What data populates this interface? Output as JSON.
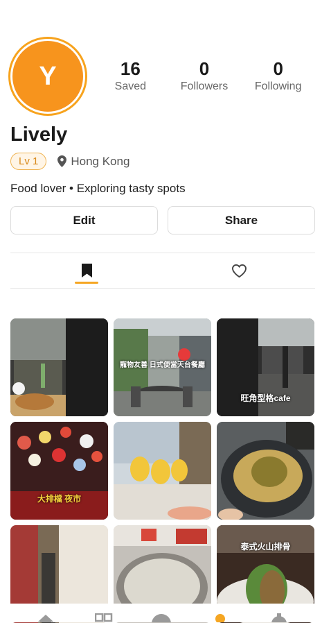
{
  "profile": {
    "avatar_letter": "Y",
    "name": "Lively",
    "level": "Lv 1",
    "location": "Hong Kong",
    "bio": "Food lover • Exploring tasty spots"
  },
  "stats": [
    {
      "value": "16",
      "label": "Saved"
    },
    {
      "value": "0",
      "label": "Followers"
    },
    {
      "value": "0",
      "label": "Following"
    }
  ],
  "actions": {
    "edit_label": "Edit",
    "share_label": "Share"
  },
  "tabs": [
    {
      "name": "saved",
      "icon": "bookmark-icon",
      "active": true
    },
    {
      "name": "liked",
      "icon": "heart-icon",
      "active": false
    }
  ],
  "grid": {
    "captions": {
      "tile2": "寵物友善 日式便當天台餐廳",
      "tile3": "旺角型格cafe",
      "tile4": "大排檔 夜市",
      "tile9": "泰式火山排骨"
    }
  },
  "bottom_nav": [
    "home-icon",
    "grid-icon",
    "circle-icon",
    "dot-icon",
    "gear-icon"
  ],
  "colors": {
    "accent": "#f5a623",
    "avatar": "#f7941d"
  }
}
